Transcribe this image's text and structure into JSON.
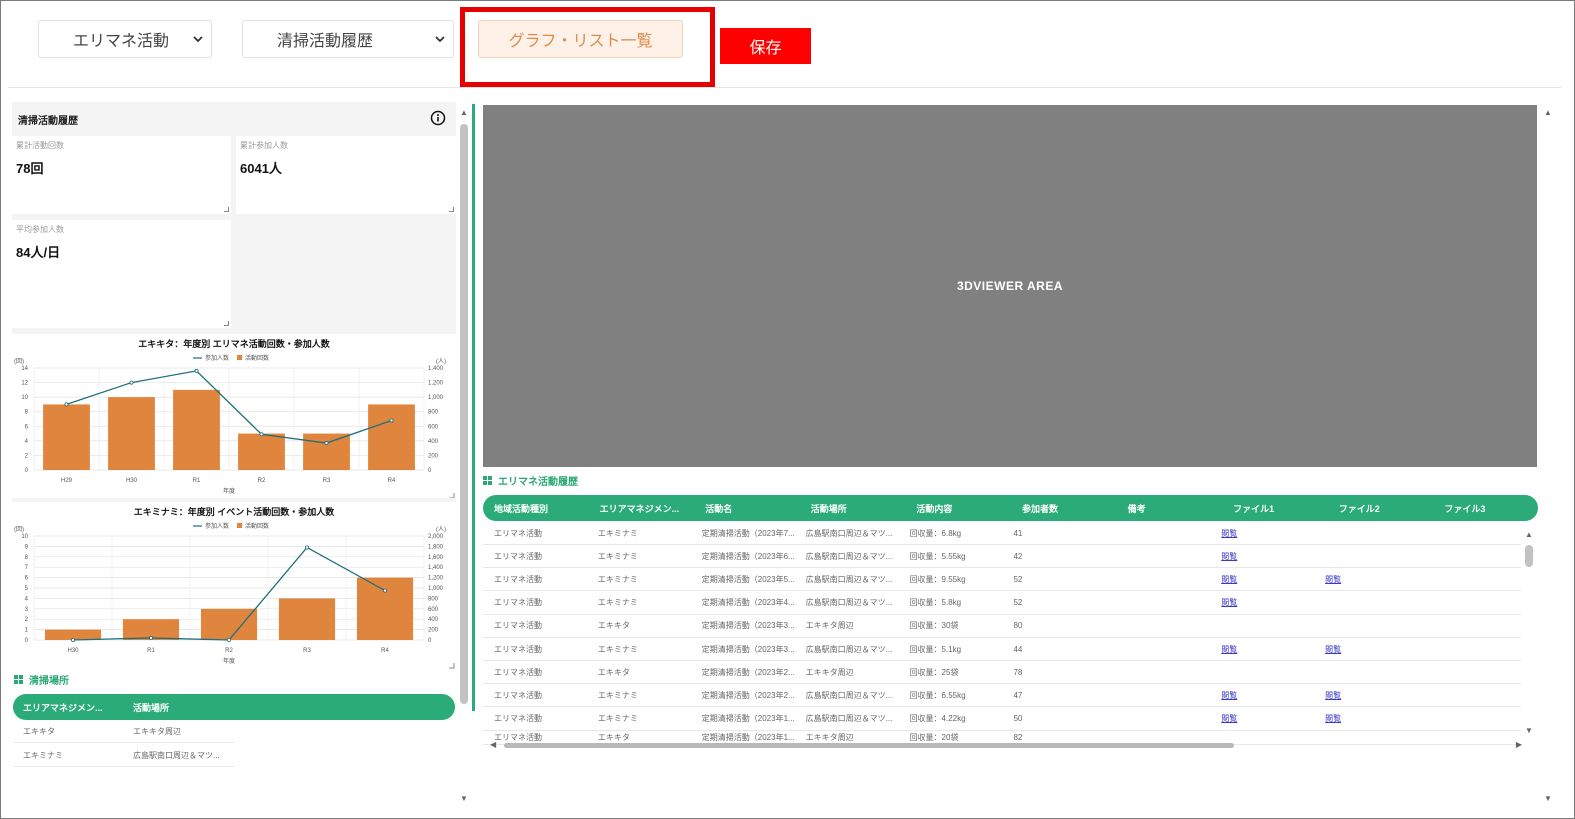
{
  "toolbar": {
    "select1": "エリマネ活動",
    "select2": "清掃活動履歴",
    "graph_btn": "グラフ・リスト一覧",
    "save_btn": "保存"
  },
  "left_panel": {
    "title": "清掃活動履歴",
    "stats": [
      {
        "label": "累計活動回数",
        "value": "78回"
      },
      {
        "label": "累計参加人数",
        "value": "6041人"
      },
      {
        "label": "平均参加人数",
        "value": "84人/日"
      }
    ]
  },
  "chart_data": [
    {
      "type": "bar",
      "title": "エキキタ：年度別 エリマネ活動回数・参加人数",
      "xlabel": "年度",
      "y_left_unit": "(回)",
      "y_right_unit": "(人)",
      "legend": [
        "参加人数",
        "活動回数"
      ],
      "legend_position": "top-center",
      "categories": [
        "H29",
        "H30",
        "R1",
        "R2",
        "R3",
        "R4"
      ],
      "series": [
        {
          "name": "活動回数",
          "type": "bar",
          "axis": "left",
          "values": [
            9,
            10,
            11,
            5,
            5,
            9
          ]
        },
        {
          "name": "参加人数",
          "type": "line",
          "axis": "right",
          "values": [
            900,
            1200,
            1360,
            490,
            370,
            680
          ]
        }
      ],
      "ylim_left": [
        0,
        14
      ],
      "ylim_right": [
        0,
        1400
      ],
      "yticks_left": [
        "0",
        "2",
        "4",
        "6",
        "8",
        "10",
        "12",
        "14"
      ],
      "yticks_right": [
        "0",
        "200",
        "400",
        "600",
        "800",
        "1,000",
        "1,200",
        "1,400"
      ],
      "colors": {
        "bar": "#e0853d",
        "line": "#1f6f7c"
      }
    },
    {
      "type": "bar",
      "title": "エキミナミ：年度別 イベント活動回数・参加人数",
      "xlabel": "年度",
      "y_left_unit": "(回)",
      "y_right_unit": "(人)",
      "legend": [
        "参加人数",
        "活動回数"
      ],
      "legend_position": "top-center",
      "categories": [
        "H30",
        "R1",
        "R2",
        "R3",
        "R4"
      ],
      "series": [
        {
          "name": "活動回数",
          "type": "bar",
          "axis": "left",
          "values": [
            1,
            2,
            3,
            4,
            6
          ]
        },
        {
          "name": "参加人数",
          "type": "line",
          "axis": "right",
          "values": [
            0,
            40,
            0,
            1780,
            950
          ]
        }
      ],
      "ylim_left": [
        0,
        10
      ],
      "ylim_right": [
        0,
        2000
      ],
      "yticks_left": [
        "0",
        "1",
        "2",
        "3",
        "4",
        "5",
        "6",
        "7",
        "8",
        "9",
        "10"
      ],
      "yticks_right": [
        "0",
        "200",
        "400",
        "600",
        "800",
        "1,000",
        "1,200",
        "1,400",
        "1,600",
        "1,800",
        "2,000"
      ],
      "colors": {
        "bar": "#e0853d",
        "line": "#1f6f7c"
      }
    }
  ],
  "cleaning_places": {
    "title": "清掃場所",
    "headers": [
      "エリアマネジメン...",
      "活動場所"
    ],
    "rows": [
      [
        "エキキタ",
        "エキキタ周辺"
      ],
      [
        "エキミナミ",
        "広島駅南口周辺＆マツ..."
      ]
    ]
  },
  "viewer": {
    "label": "3DVIEWER AREA"
  },
  "activity_table": {
    "title": "エリマネ活動履歴",
    "headers": [
      "地域活動種別",
      "エリアマネジメン...",
      "活動名",
      "活動場所",
      "活動内容",
      "参加者数",
      "備考",
      "ファイル1",
      "ファイル2",
      "ファイル3"
    ],
    "rows": [
      [
        "エリマネ活動",
        "エキミナミ",
        "定期清掃活動（2023年7...",
        "広島駅南口周辺＆マツ...",
        "回収量：6.8kg",
        "41",
        "",
        "閲覧",
        "",
        ""
      ],
      [
        "エリマネ活動",
        "エキミナミ",
        "定期清掃活動（2023年6...",
        "広島駅南口周辺＆マツ...",
        "回収量：5.55kg",
        "42",
        "",
        "閲覧",
        "",
        ""
      ],
      [
        "エリマネ活動",
        "エキミナミ",
        "定期清掃活動（2023年5...",
        "広島駅南口周辺＆マツ...",
        "回収量：9.55kg",
        "52",
        "",
        "閲覧",
        "閲覧",
        ""
      ],
      [
        "エリマネ活動",
        "エキミナミ",
        "定期清掃活動（2023年4...",
        "広島駅南口周辺＆マツ...",
        "回収量：5.8kg",
        "52",
        "",
        "閲覧",
        "",
        ""
      ],
      [
        "エリマネ活動",
        "エキキタ",
        "定期清掃活動（2023年3...",
        "エキキタ周辺",
        "回収量：30袋",
        "80",
        "",
        "",
        "",
        ""
      ],
      [
        "エリマネ活動",
        "エキミナミ",
        "定期清掃活動（2023年3...",
        "広島駅南口周辺＆マツ...",
        "回収量：5.1kg",
        "44",
        "",
        "閲覧",
        "閲覧",
        ""
      ],
      [
        "エリマネ活動",
        "エキキタ",
        "定期清掃活動（2023年2...",
        "エキキタ周辺",
        "回収量：25袋",
        "78",
        "",
        "",
        "",
        ""
      ],
      [
        "エリマネ活動",
        "エキミナミ",
        "定期清掃活動（2023年2...",
        "広島駅南口周辺＆マツ...",
        "回収量：6.55kg",
        "47",
        "",
        "閲覧",
        "閲覧",
        ""
      ],
      [
        "エリマネ活動",
        "エキミナミ",
        "定期清掃活動（2023年1...",
        "広島駅南口周辺＆マツ...",
        "回収量：4.22kg",
        "50",
        "",
        "閲覧",
        "閲覧",
        ""
      ],
      [
        "エリマネ活動",
        "エキキタ",
        "定期清掃活動（2023年1...",
        "エキキタ周辺",
        "回収量：20袋",
        "82",
        "",
        "",
        "",
        ""
      ]
    ]
  }
}
